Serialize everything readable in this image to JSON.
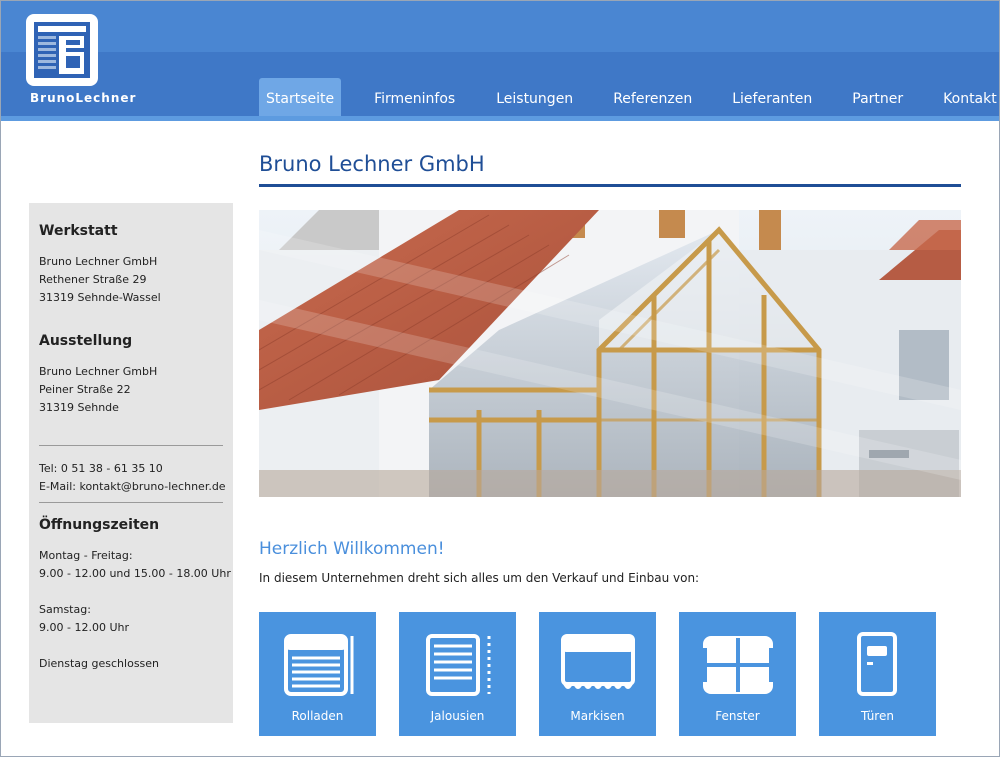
{
  "brand": {
    "name": "BrunoLechner",
    "colors": {
      "header": "#3f78c7",
      "header_top": "#4a86d2",
      "accent": "#1f4e96",
      "tile": "#4a94df"
    }
  },
  "nav": {
    "items": [
      {
        "label": "Startseite",
        "active": true
      },
      {
        "label": "Firmeninfos"
      },
      {
        "label": "Leistungen"
      },
      {
        "label": "Referenzen"
      },
      {
        "label": "Lieferanten"
      },
      {
        "label": "Partner"
      },
      {
        "label": "Kontakt"
      }
    ]
  },
  "main": {
    "title": "Bruno Lechner GmbH",
    "welcome": "Herzlich Willkommen!",
    "intro": "In diesem Unternehmen dreht sich alles um den Verkauf und Einbau von:",
    "tiles": [
      {
        "label": "Rolladen",
        "icon": "roller-shutter-icon"
      },
      {
        "label": "Jalousien",
        "icon": "blinds-icon"
      },
      {
        "label": "Markisen",
        "icon": "awning-icon"
      },
      {
        "label": "Fenster",
        "icon": "window-icon"
      },
      {
        "label": "Türen",
        "icon": "door-icon"
      }
    ]
  },
  "sidebar": {
    "werkstatt": {
      "heading": "Werkstatt",
      "lines": [
        "Bruno Lechner GmbH",
        "Rethener Straße 29",
        "31319 Sehnde-Wassel"
      ]
    },
    "ausstellung": {
      "heading": "Ausstellung",
      "lines": [
        "Bruno Lechner GmbH",
        "Peiner Straße 22",
        "31319 Sehnde"
      ]
    },
    "contact": {
      "phone": "Tel: 0 51 38 - 61 35 10",
      "email": "E-Mail: kontakt@bruno-lechner.de"
    },
    "hours": {
      "heading": "Öffnungszeiten",
      "weekday_label": "Montag - Freitag:",
      "weekday_hours": "9.00 - 12.00 und 15.00 - 18.00 Uhr",
      "saturday_label": "Samstag:",
      "saturday_hours": "9.00 - 12.00 Uhr",
      "closed": "Dienstag geschlossen"
    }
  }
}
